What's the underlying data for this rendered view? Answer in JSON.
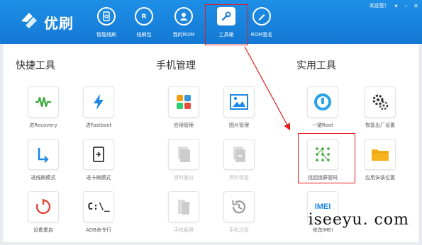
{
  "app": {
    "title": "优刷"
  },
  "window": {
    "greeting": "欢迎您！"
  },
  "nav": [
    {
      "label": "智能线刷",
      "icon": "smart-flash-icon"
    },
    {
      "label": "线刷包",
      "icon": "rom-package-icon"
    },
    {
      "label": "我的ROM",
      "icon": "my-rom-icon"
    },
    {
      "label": "工具箱",
      "icon": "toolbox-icon",
      "active": true
    },
    {
      "label": "ROM签名",
      "icon": "rom-sign-icon"
    }
  ],
  "sections": {
    "quick": "快捷工具",
    "phone": "手机管理",
    "util": "实用工具"
  },
  "tools": {
    "recovery": "进Recovery",
    "fastboot": "进Fastboot",
    "flash_mode": "进线刷模式",
    "card_mode": "进卡刷模式",
    "reboot": "设备重启",
    "adb": "ADB命令行",
    "adb_glyph": "C:\\_",
    "app_mgr": "应用管理",
    "pic_mgr": "图片管理",
    "backup": "资料备份",
    "restore": "资料恢复",
    "device_shot": "手机截屏",
    "restore_bak": "手机还原",
    "root": "一键Root",
    "factory": "恢复出厂设置",
    "unlock": "找回锁屏密码",
    "app_loc": "应用安装位置",
    "imei": "修改IMEI",
    "imei_glyph": "IMEI"
  },
  "watermark": "iseeyu. com",
  "colors": {
    "header": "#1479d4",
    "highlight": "#e51b1b"
  }
}
